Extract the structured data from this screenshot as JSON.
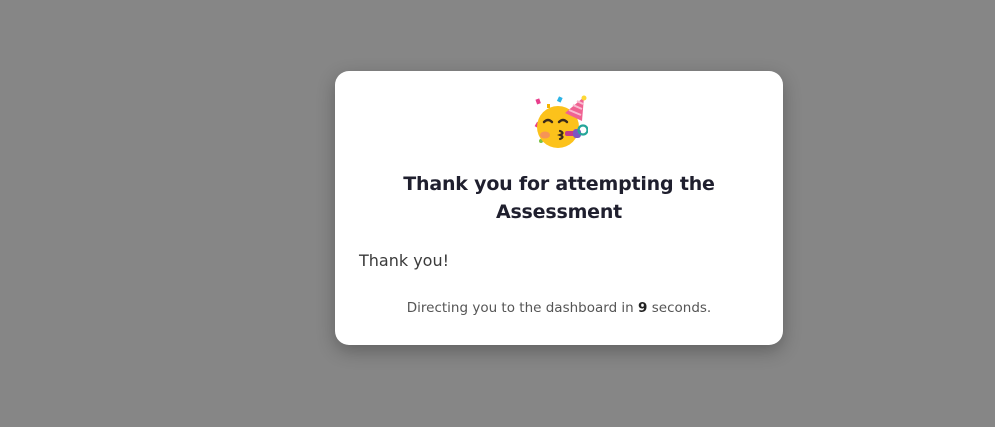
{
  "modal": {
    "icon": "party-face-icon",
    "title_line1": "Thank you for attempting the",
    "title_line2": "Assessment",
    "message": "Thank you!",
    "redirect_prefix": "Directing you to the dashboard in",
    "redirect_seconds": "9",
    "redirect_suffix": "seconds."
  },
  "colors": {
    "overlay": "#868686",
    "card": "#ffffff",
    "title": "#1f1f2e",
    "text": "#555555"
  }
}
